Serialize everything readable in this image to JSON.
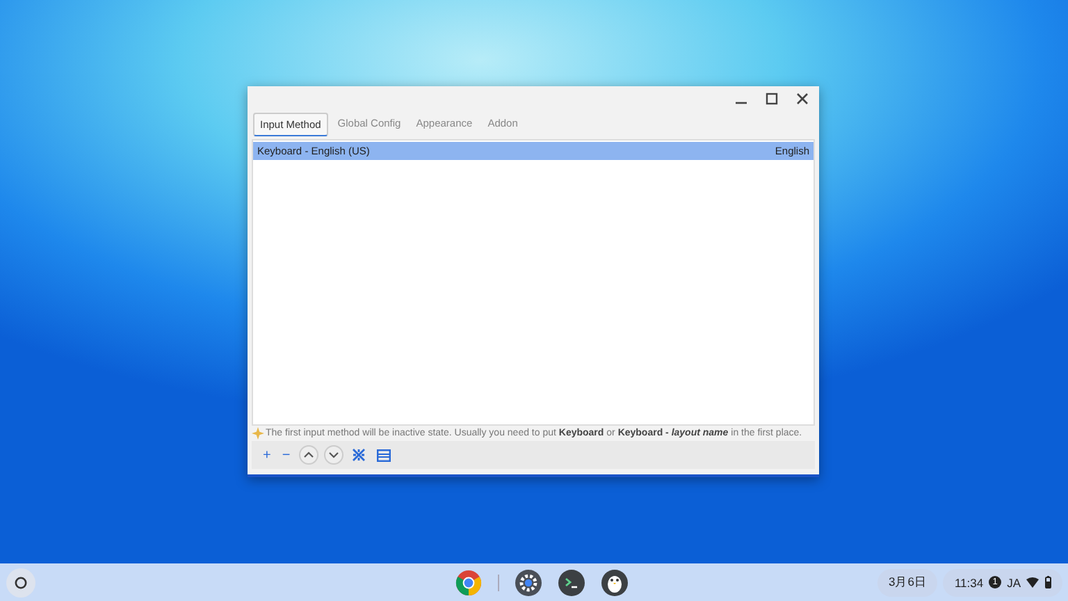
{
  "window": {
    "title_controls": [
      {
        "kind": "minimize"
      },
      {
        "kind": "maximize"
      },
      {
        "kind": "close"
      }
    ]
  },
  "tabs": [
    {
      "label": "Input Method",
      "selected": true
    },
    {
      "label": "Global Config",
      "selected": false
    },
    {
      "label": "Appearance",
      "selected": false
    },
    {
      "label": "Addon",
      "selected": false
    }
  ],
  "input_methods": [
    {
      "name": "Keyboard - English (US)",
      "language": "English",
      "selected": true
    }
  ],
  "hint": "The first input method will be inactive state. Usually you need to put **Keyboard** or **Keyboard -** *layout name* in the first place.",
  "toolbar": [
    {
      "kind": "text",
      "label": "+"
    },
    {
      "kind": "text",
      "label": "−"
    },
    {
      "kind": "up"
    },
    {
      "kind": "down"
    },
    {
      "kind": "configure"
    },
    {
      "kind": "layout"
    }
  ],
  "shelf": {
    "apps": [
      {
        "kind": "browser"
      },
      {
        "kind": "settings"
      },
      {
        "kind": "terminal"
      },
      {
        "kind": "penguin"
      }
    ],
    "date": "3月6日",
    "time": "11:34",
    "notification_count": "1",
    "ime": "JA"
  }
}
